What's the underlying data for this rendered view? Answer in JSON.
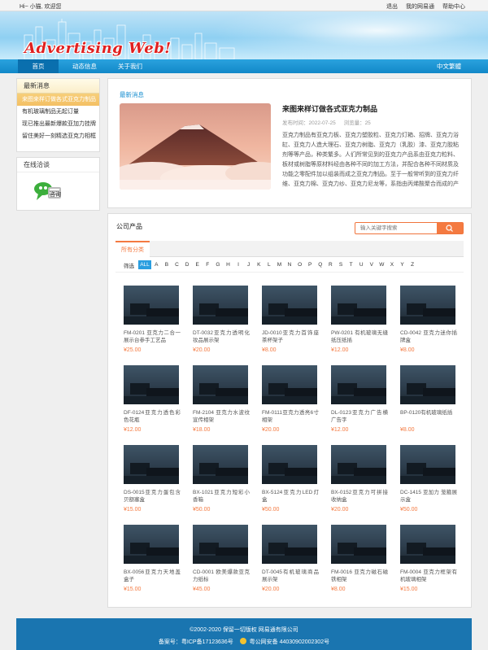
{
  "topbar": {
    "greeting": "Hi~ 小猫, 欢迎您",
    "links": [
      "退出",
      "我的网易通",
      "帮助中心"
    ]
  },
  "banner": {
    "logo_text": "Advertising Web!"
  },
  "nav": {
    "items": [
      "首页",
      "动态信息",
      "关于我们"
    ],
    "lang": "中文繁體"
  },
  "sidebar": {
    "news_title": "最新消息",
    "news_items": [
      "来图来样订做各式亚克力制品",
      "有机玻璃制品无起订量",
      "现已推出最新爆款亚加力挂牌",
      "留住美好一刻精选亚克力相框"
    ],
    "chat_title": "在线洽谈",
    "chat_button": "咨询"
  },
  "news": {
    "section_title": "最新消息",
    "headline": "来图来样订做各式亚克力制品",
    "date_label": "发布时间：2022-07-25",
    "views_label": "浏览量：25",
    "body": "亚克力制品有亚克力板、亚克力塑胶粒、亚克力灯箱、招牌、亚克力浴缸、亚克力人造大理石、亚克力树脂、亚克力（乳胶）漆、亚克力胶粘剂等等产品，种类繁多。人们所常见到的亚克力产品系由亚克力粒料、板材或树脂等原材料经由各种不同的加工方法，并配合各种不同材质及功能之零配件加以组装而成之亚克力制品。至于一般常听到的亚克力纤维、亚克力棉、亚克力纱、亚克力尼龙等，系指由丙烯酸聚合而成的产品。"
  },
  "products": {
    "section_title": "公司产品",
    "search_placeholder": "输入关键字搜索",
    "tab_all": "所有分类",
    "filter_label": "筛选",
    "letters": [
      "ALL",
      "A",
      "B",
      "C",
      "D",
      "E",
      "F",
      "G",
      "H",
      "I",
      "J",
      "K",
      "L",
      "M",
      "N",
      "O",
      "P",
      "Q",
      "R",
      "S",
      "T",
      "U",
      "V",
      "W",
      "X",
      "Y",
      "Z"
    ],
    "items": [
      {
        "name": "FM-0201 亚克力二合一展示台参手工艺品",
        "price": "¥25.00"
      },
      {
        "name": "DT-0032亚克力透明化妆品展示架",
        "price": "¥20.00"
      },
      {
        "name": "JD-0010亚克力首饰座茶杯架子",
        "price": "¥8.00"
      },
      {
        "name": "PW-0201 有机玻璃无缝纸压纸插",
        "price": "¥12.00"
      },
      {
        "name": "CD-0042 亚克力迷你插牌盒",
        "price": "¥8.00"
      },
      {
        "name": "DF-0124亚克力透色彩色花瓶",
        "price": "¥12.00"
      },
      {
        "name": "FM-2104 亚克力水波纹宣传相架",
        "price": "¥18.00"
      },
      {
        "name": "FM-0111亚克力透亮6寸相架",
        "price": "¥20.00"
      },
      {
        "name": "DL-0123亚克力广告横广告字",
        "price": "¥12.00"
      },
      {
        "name": "BP-0120有机玻璃纸插",
        "price": "¥8.00"
      },
      {
        "name": "DS-0015亚克力蛋包含贝额塞盒",
        "price": "¥15.00"
      },
      {
        "name": "BX-1021亚克力短彩小香箱",
        "price": "¥50.00"
      },
      {
        "name": "BX-5124亚克力LED灯盒",
        "price": "¥50.00"
      },
      {
        "name": "BX-0152亚克力可拼接收纳盒",
        "price": "¥20.00"
      },
      {
        "name": "DC-1415 亚加力 笼箍展示盒",
        "price": "¥50.00"
      },
      {
        "name": "BX-0056亚克力天地盖盒子",
        "price": "¥15.00"
      },
      {
        "name": "CD-0001 欧美爆款亚克力纸标",
        "price": "¥45.00"
      },
      {
        "name": "DT-0045有机玻璃商品展示架",
        "price": "¥20.00"
      },
      {
        "name": "FM-0016 亚克力磁石磁铁相架",
        "price": "¥8.00"
      },
      {
        "name": "FM-0004 亚克力框架有机玻璃相架",
        "price": "¥15.00"
      }
    ]
  },
  "footer": {
    "copyright": "©2002-2020 保留一切版权 网易通有限公司",
    "icp": "备案号：粤ICP备17123636号",
    "police": "粤公网安备 44030902002302号"
  },
  "colors": {
    "nav": "#1a8fd0",
    "accent": "#f47a41",
    "filter_active": "#2a9ee0",
    "footer": "#1a75b0"
  }
}
